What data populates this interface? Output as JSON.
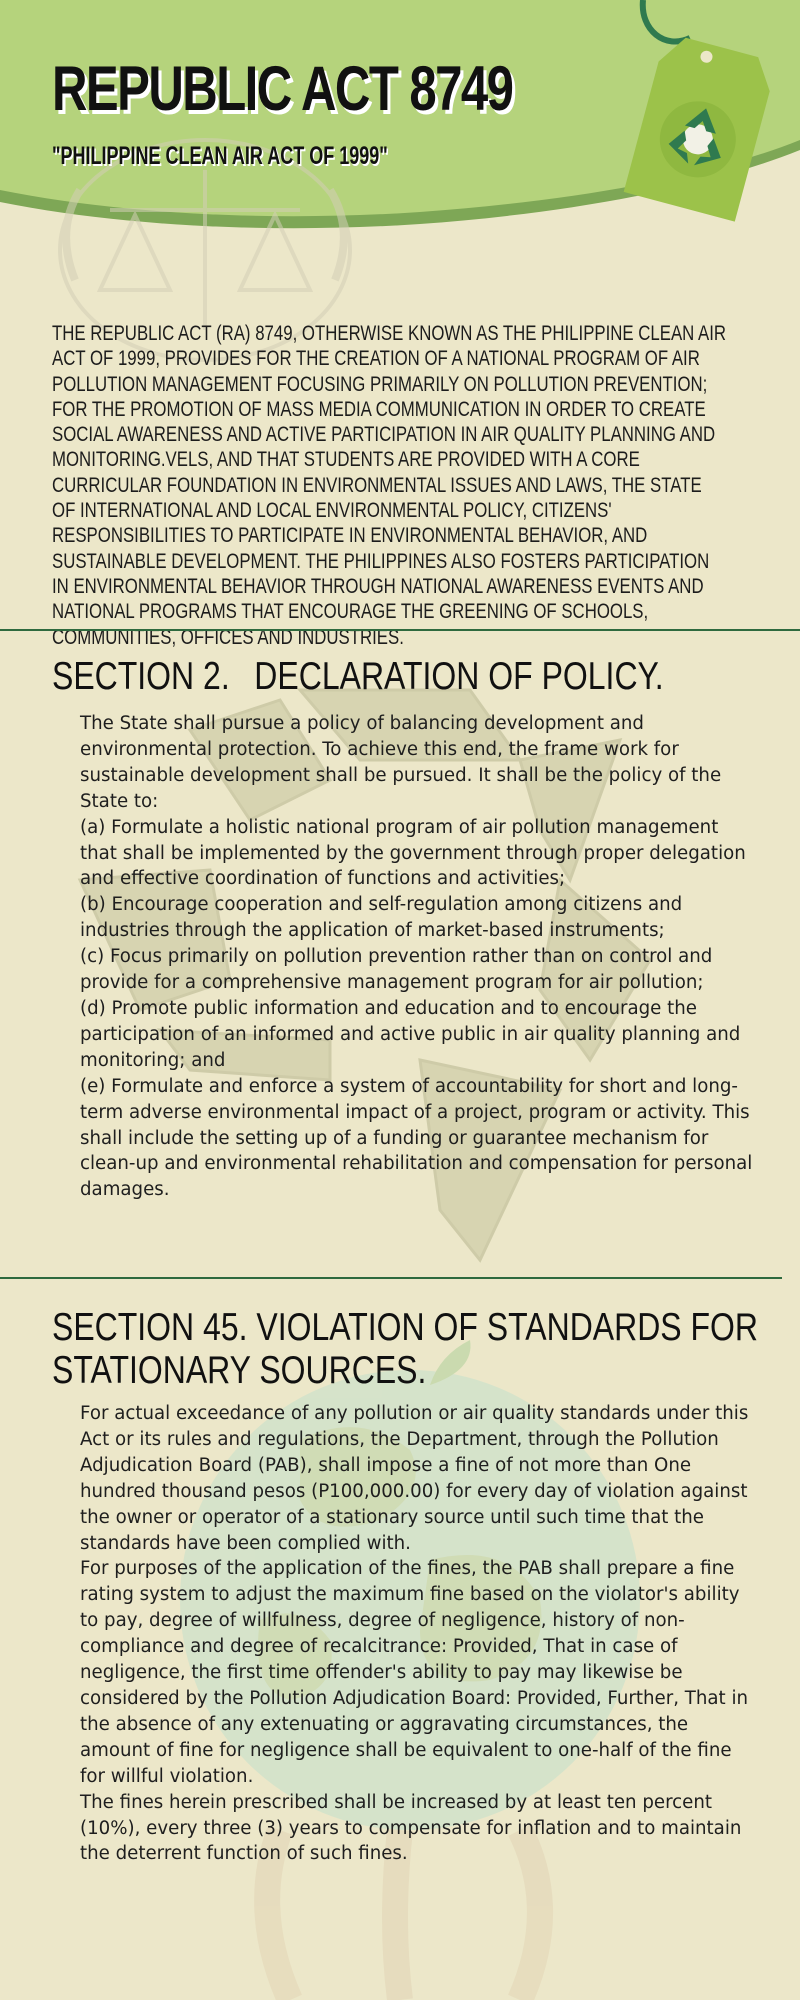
{
  "header": {
    "title": "REPUBLIC ACT 8749",
    "subtitle": "\"PHILIPPINE CLEAN AIR ACT OF 1999\""
  },
  "intro": "The Republic Act (RA) 8749, otherwise known as the Philippine Clean Air Act of 1999, provides for the creation of a national program of air pollution management focusing primarily on pollution prevention; for the promotion of mass media communication in order to create social awareness and active participation in air quality planning and monitoring.vels, and that students are provided with a core curricular foundation in environmental issues and laws, the state of international and local environmental policy, citizens' responsibilities to participate in environmental behavior, and sustainable development. The Philippines also fosters participation in environmental behavior through national awareness events and national programs that encourage the greening of schools, communities, offices and industries.",
  "section2": {
    "number": "SECTION 2.",
    "title": "DECLARATION OF POLICY.",
    "paragraphs": [
      "The State shall pursue a policy of balancing development and environmental protection. To achieve this end, the frame work for sustainable development shall be pursued. It shall be the policy of the State to:",
      "(a) Formulate a holistic national program of air pollution management that shall be implemented by the government through proper delegation and effective coordination of functions and activities;",
      "(b) Encourage cooperation and self-regulation among citizens and industries through the application of market-based instruments;",
      "(c) Focus primarily on pollution prevention rather than on control and provide for a comprehensive management program for air pollution;",
      "(d) Promote public information and education and to encourage the participation of an informed and active public in air quality planning and monitoring; and",
      "(e) Formulate and enforce a system of accountability for short and long-term adverse environmental impact of a project, program or activity. This shall include the setting up of a funding or guarantee mechanism for clean-up and environmental rehabilitation and compensation for personal damages."
    ]
  },
  "section45": {
    "heading": "SECTION 45. VIOLATION OF STANDARDS FOR STATIONARY SOURCES.",
    "paragraphs": [
      "For actual exceedance of any pollution or air quality standards under this Act or its rules and regulations, the Department, through the Pollution Adjudication Board (PAB), shall impose a fine of not more than One hundred thousand pesos (P100,000.00) for every day of violation against the owner or operator of a stationary source until such time that the standards have been complied with.",
      "For purposes of the application of the fines, the PAB shall prepare a fine rating system to adjust the maximum fine based on the violator's ability to pay, degree of willfulness, degree of negligence, history of non-compliance and degree of recalcitrance: Provided, That in case of negligence, the first time offender's ability to pay may likewise be considered by the Pollution Adjudication Board: Provided, Further, That in the absence of any extenuating or aggravating circumstances, the amount of fine for negligence shall be equivalent to one-half of the fine for willful violation.",
      "The fines herein prescribed shall be increased by at least ten percent (10%), every three (3) years to compensate for inflation and to maintain the deterrent function of such fines."
    ]
  },
  "colors": {
    "background": "#ece7c9",
    "header_wave": "#b5d37c",
    "header_wave_edge": "#7ea756",
    "divider": "#2e6a3e",
    "tag": "#9cc24a",
    "recycle_icon": "#2f7a4f"
  },
  "icons": [
    "recycle-tag-icon",
    "scales-of-justice-icon",
    "recycle-symbol-icon",
    "globe-icon"
  ]
}
